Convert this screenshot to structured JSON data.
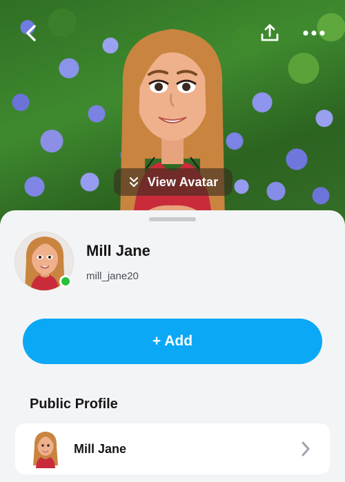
{
  "header": {
    "view_avatar_label": "View Avatar"
  },
  "profile": {
    "display_name": "Mill Jane",
    "username": "mill_jane20",
    "online": true
  },
  "actions": {
    "add_label": "+ Add"
  },
  "public_profile": {
    "section_title": "Public Profile",
    "name": "Mill Jane"
  },
  "colors": {
    "accent": "#0aa8f5",
    "online": "#27c23a"
  },
  "icons": [
    "back-icon",
    "share-icon",
    "more-icon",
    "double-chevron-down-icon",
    "chevron-right-icon"
  ]
}
